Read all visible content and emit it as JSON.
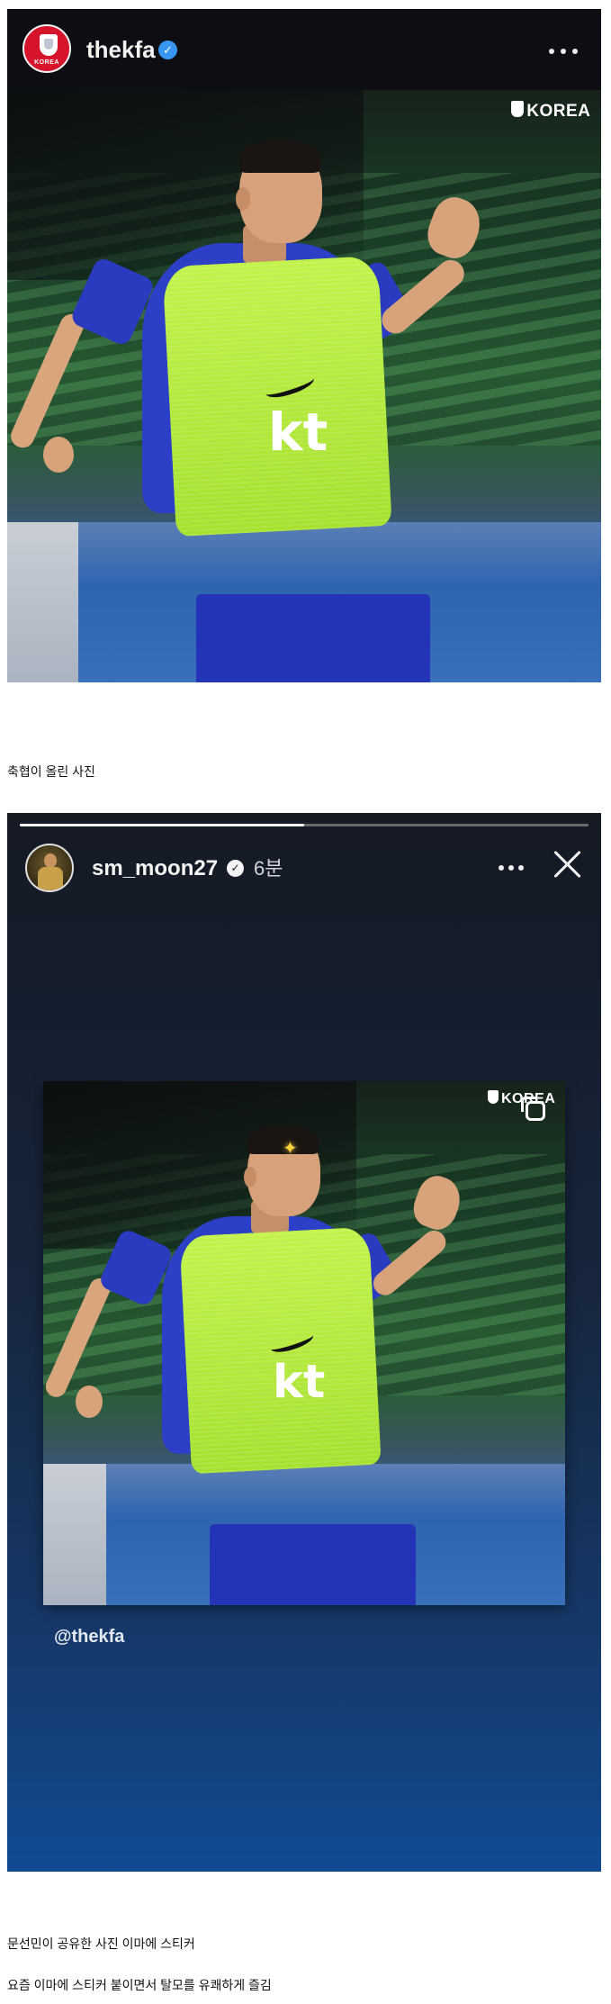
{
  "post": {
    "username": "thekfa",
    "verified_mark": "✓",
    "avatar_icon": "kfa-crest-icon",
    "avatar_text": "KOREA",
    "photo_watermark": "KOREA",
    "kit_sponsor": "kt"
  },
  "captions": {
    "first": "축협이 올린 사진",
    "second": "문선민이 공유한 사진 이마에 스티커",
    "third": "요즘 이마에 스티커 붙이면서 탈모를 유쾌하게 즐김"
  },
  "story": {
    "username": "sm_moon27",
    "verified_mark": "✓",
    "time_ago": "6분",
    "progress": 0.5,
    "photo_watermark": "KOREA",
    "kit_sponsor": "kt",
    "sticker_glyph": "✦",
    "mention": "@thekfa"
  },
  "colors": {
    "instagram_dark": "#0c0e13",
    "verified_blue": "#3897f0",
    "bib_green": "#b7f03c",
    "kit_blue": "#2b3fc7",
    "kfa_red": "#d6142c"
  }
}
